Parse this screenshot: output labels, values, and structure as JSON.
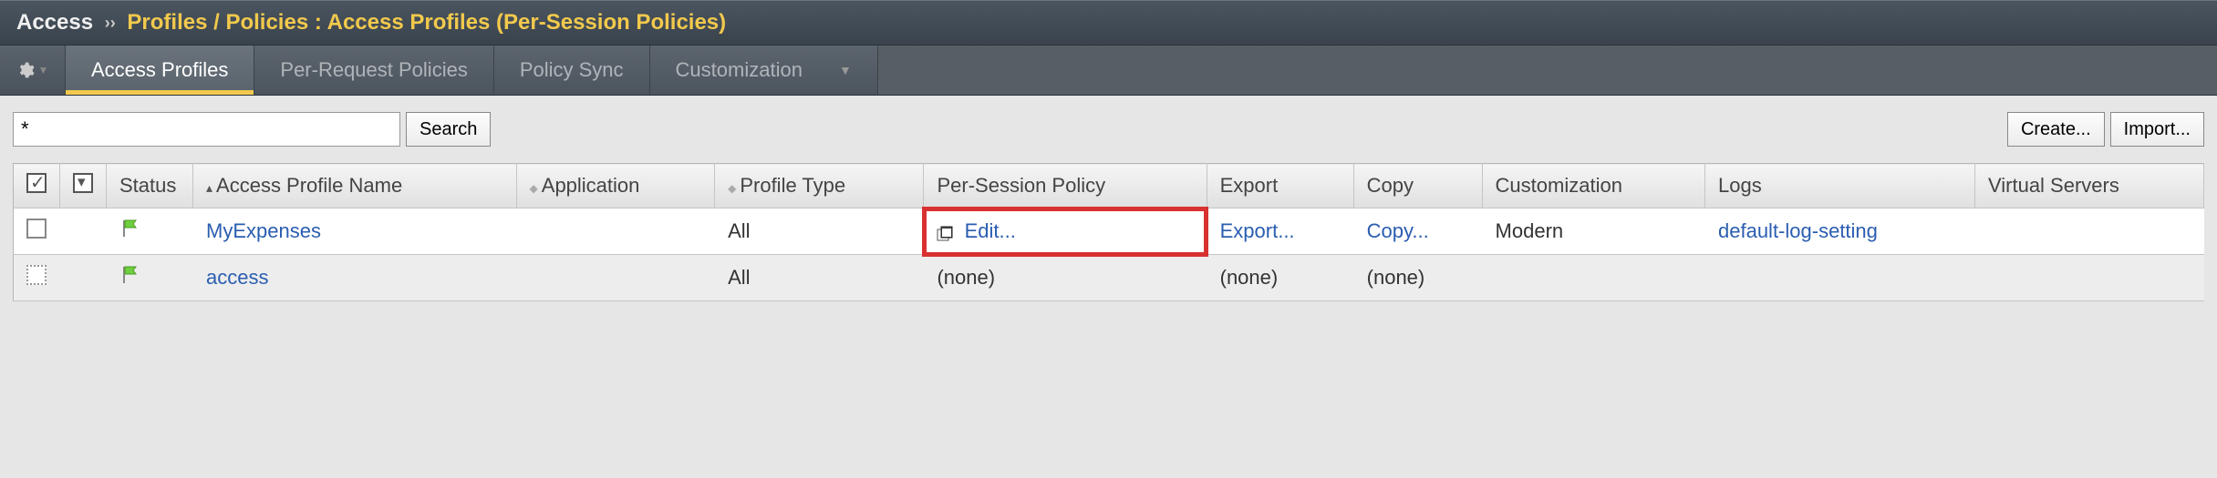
{
  "breadcrumb": {
    "root": "Access",
    "sep": "››",
    "rest": "Profiles / Policies : Access Profiles (Per-Session Policies)"
  },
  "tabs": [
    {
      "label": "Access Profiles",
      "active": true
    },
    {
      "label": "Per-Request Policies",
      "active": false
    },
    {
      "label": "Policy Sync",
      "active": false
    },
    {
      "label": "Customization",
      "active": false,
      "dropdown": true
    }
  ],
  "search": {
    "value": "*",
    "button": "Search"
  },
  "actions": {
    "create": "Create...",
    "import": "Import..."
  },
  "table": {
    "headers": {
      "status": "Status",
      "name": "Access Profile Name",
      "application": "Application",
      "profile_type": "Profile Type",
      "per_session": "Per-Session Policy",
      "export": "Export",
      "copy": "Copy",
      "customization": "Customization",
      "logs": "Logs",
      "virtual_servers": "Virtual Servers"
    },
    "rows": [
      {
        "checkbox": "normal",
        "name": "MyExpenses",
        "application": "",
        "profile_type": "All",
        "per_session": "Edit...",
        "export": "Export...",
        "copy": "Copy...",
        "customization": "Modern",
        "logs": "default-log-setting",
        "virtual_servers": "",
        "highlight": true
      },
      {
        "checkbox": "dashed",
        "name": "access",
        "application": "",
        "profile_type": "All",
        "per_session": "(none)",
        "export": "(none)",
        "copy": "(none)",
        "customization": "",
        "logs": "",
        "virtual_servers": ""
      }
    ]
  }
}
